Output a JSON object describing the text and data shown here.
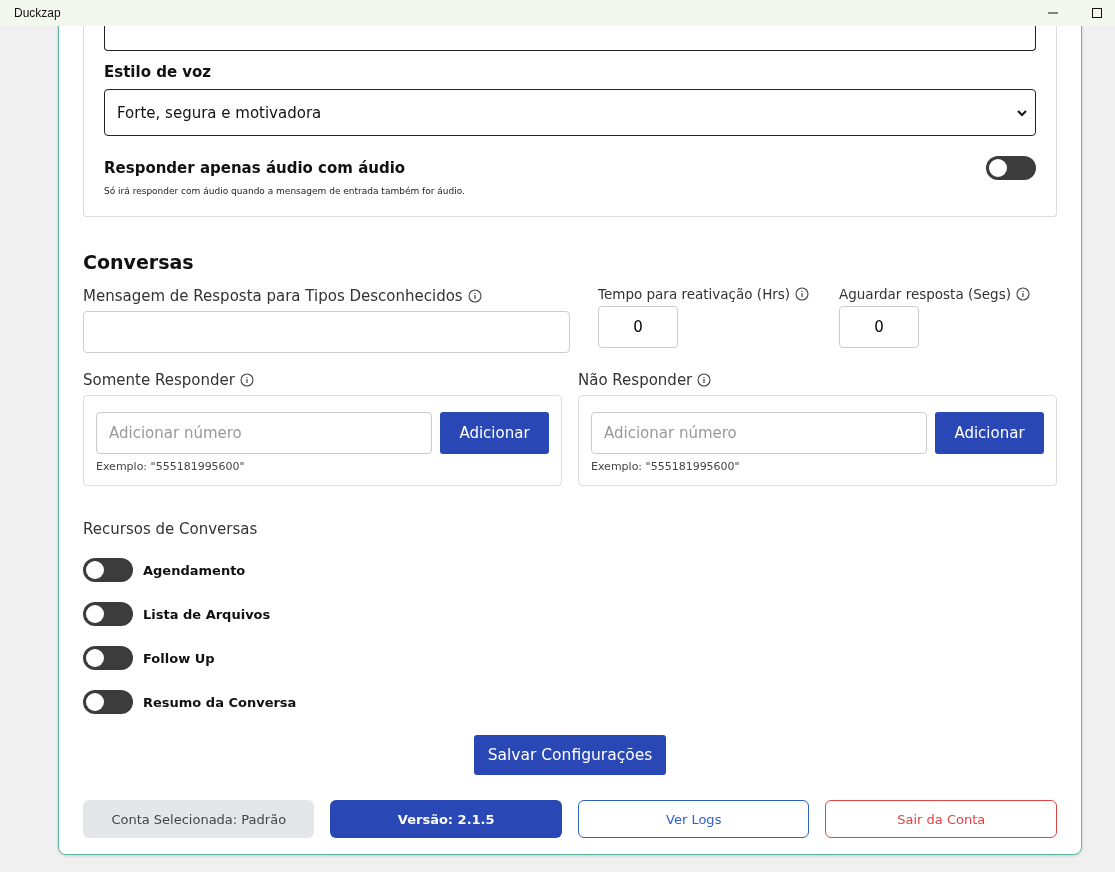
{
  "window": {
    "title": "Duckzap"
  },
  "voice": {
    "style_label": "Estilo de voz",
    "style_value": "Forte, segura e motivadora",
    "audio_only": {
      "label": "Responder apenas áudio com áudio",
      "on": false,
      "hint": "Só irá responder com áudio quando a mensagem de entrada também for áudio."
    }
  },
  "conversas": {
    "title": "Conversas",
    "unknown_message": {
      "label": "Mensagem de Resposta para Tipos Desconhecidos"
    },
    "reactivation": {
      "label": "Tempo para reativação (Hrs)",
      "value": "0"
    },
    "wait": {
      "label": "Aguardar resposta (Segs)",
      "value": "0"
    },
    "lists": [
      {
        "label": "Somente Responder",
        "placeholder": "Adicionar número",
        "button": "Adicionar",
        "example": "Exemplo: \"555181995600\""
      },
      {
        "label": "Não Responder",
        "placeholder": "Adicionar número",
        "button": "Adicionar",
        "example": "Exemplo: \"555181995600\""
      }
    ],
    "features_title": "Recursos de Conversas",
    "features": [
      {
        "label": "Agendamento",
        "on": false
      },
      {
        "label": "Lista de Arquivos",
        "on": false
      },
      {
        "label": "Follow Up",
        "on": false
      },
      {
        "label": "Resumo da Conversa",
        "on": false
      }
    ]
  },
  "save_button": "Salvar Configurações",
  "footer": {
    "account": "Conta Selecionada: Padrão",
    "version": "Versão: 2.1.5",
    "logs": "Ver Logs",
    "logout": "Sair da Conta"
  }
}
